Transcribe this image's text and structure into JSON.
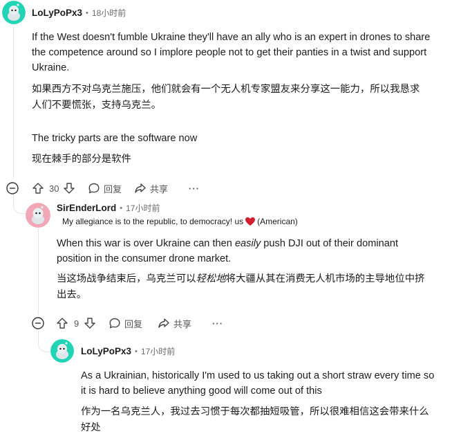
{
  "comments": [
    {
      "username": "LoLyPoPx3",
      "time": "18小时前",
      "paragraphs": [
        "If the West doesn't fumble Ukraine they'll have an ally who is an expert in drones to share",
        "the competence around so I implore people not to get their panties in a twist and support",
        "Ukraine."
      ],
      "translation": [
        "如果西方不对乌克兰施压，他们就会有一个无人机专家盟友来分享这一能力，所以我恳求",
        "人们不要慌张，支持乌克兰。"
      ],
      "paragraph2": "The tricky parts are the software now",
      "translation2": "现在棘手的部分是软件",
      "votes": "30",
      "reply_label": "回复",
      "share_label": "共享",
      "more_label": "···",
      "avatar_color": "#20d4b5"
    },
    {
      "username": "SirEnderLord",
      "time": "17小时前",
      "flair_text": "My allegiance is to the republic, to democracy! us",
      "flair_suffix": "(American)",
      "paragraph_line1": "When this war is over Ukraine can then ",
      "paragraph_emph": "easily",
      "paragraph_line1_rest": " push DJI out of their dominant",
      "paragraph_line2": "position in the consumer drone market.",
      "translation_pre": "当这场战争结束后，乌克兰可以",
      "translation_emph": "轻松地",
      "translation_post": "将大疆从其在消费无人机市场的主导地位中挤",
      "translation_line2": "出去。",
      "votes": "9",
      "reply_label": "回复",
      "share_label": "共享",
      "more_label": "···",
      "avatar_color": "#f2a7b6"
    },
    {
      "username": "LoLyPoPx3",
      "time": "17小时前",
      "paragraphs": [
        "As a Ukrainian, historically I'm used to us taking out a short straw every time so",
        "it is hard to believe anything good will come out of this"
      ],
      "translation": [
        "作为一名乌克兰人，我过去习惯于每次都抽短吸管，所以很难相信这会带来什么",
        "好处"
      ],
      "avatar_color": "#20d4b5"
    }
  ],
  "colors": {
    "text": "#1c1c1c",
    "muted": "#6a6a6a",
    "heart": "#d11f2e"
  }
}
